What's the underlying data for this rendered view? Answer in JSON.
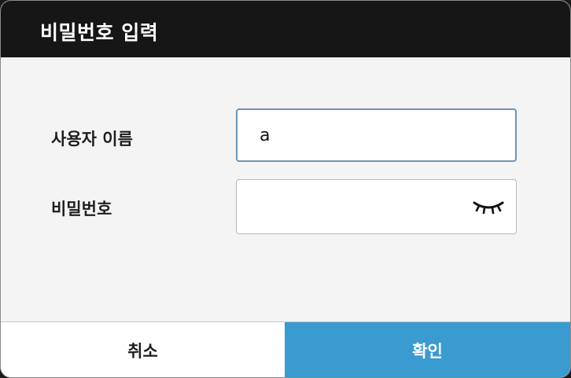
{
  "dialog": {
    "title": "비밀번호 입력",
    "username_label": "사용자 이름",
    "username_value": "a",
    "password_label": "비밀번호",
    "password_value": "",
    "password_visibility_icon": "eye-closed-icon",
    "cancel_label": "취소",
    "ok_label": "확인"
  },
  "colors": {
    "titlebar": "#161616",
    "ok_button": "#3a9bd1",
    "focused_border": "#6f94b4"
  }
}
